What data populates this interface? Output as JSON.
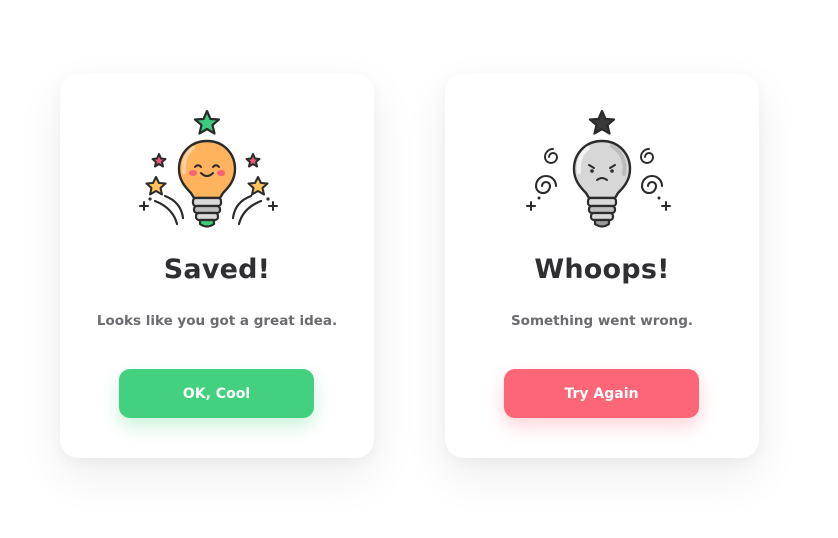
{
  "colors": {
    "success_accent": "#43d17f",
    "error_accent": "#fd6677",
    "title_text": "#2f2f33",
    "message_text": "#6b6b70",
    "bulb_happy": "#ffb35c",
    "star_green": "#3ccb7f",
    "star_pink": "#f2557a",
    "star_yellow": "#ffc45a",
    "bulb_sad": "#d7d7d7"
  },
  "success_dialog": {
    "icon": "happy-lightbulb-icon",
    "title": "Saved!",
    "message": "Looks like you got a great idea.",
    "button_label": "OK, Cool"
  },
  "error_dialog": {
    "icon": "sad-lightbulb-icon",
    "title": "Whoops!",
    "message": "Something went wrong.",
    "button_label": "Try Again"
  }
}
